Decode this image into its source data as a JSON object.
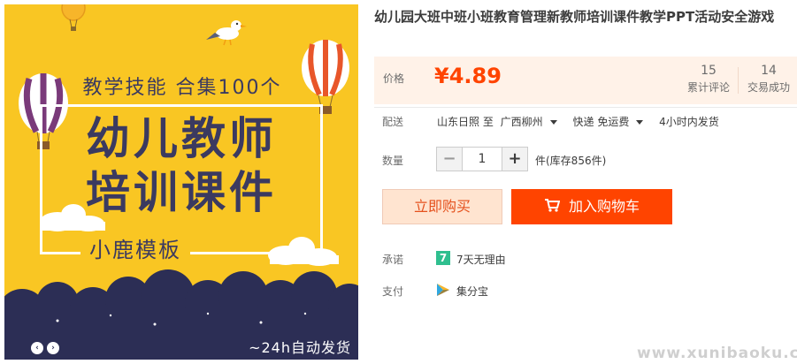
{
  "product": {
    "title": "幼儿园大班中班小班教育管理新教师培训课件教学PPT活动安全游戏"
  },
  "image": {
    "headline_small": "教学技能 合集100个",
    "headline_line1": "幼儿教师",
    "headline_line2": "培训课件",
    "brand": "小鹿模板",
    "shipping_badge": "~24h自动发货",
    "prev_arrow": "‹",
    "next_arrow": "›"
  },
  "price": {
    "label": "价格",
    "value": "¥4.89",
    "reviews_count": "15",
    "reviews_label": "累计评论",
    "sales_count": "14",
    "sales_label": "交易成功"
  },
  "delivery": {
    "label": "配送",
    "from": "山东日照 至",
    "to": "广西柳州",
    "method": "快递 免运费",
    "ship_time": "4小时内发货"
  },
  "quantity": {
    "label": "数量",
    "minus": "−",
    "value": "1",
    "plus": "+",
    "stock": "件(库存856件)"
  },
  "actions": {
    "buy_now": "立即购买",
    "add_to_cart": "加入购物车"
  },
  "services": {
    "promise_label": "承诺",
    "promise_badge": "7",
    "promise_text": "7天无理由",
    "pay_label": "支付",
    "pay_text": "集分宝"
  },
  "watermark": "www.xunibaoku.com",
  "colors": {
    "accent": "#ff4400",
    "price_panel_bg": "#fff2e8",
    "image_bg": "#f9c623",
    "navy": "#3b3a60",
    "promise_green": "#2fbf8f"
  },
  "icons": [
    "balloon-left-icon",
    "balloon-right-icon",
    "seagull-icon",
    "cart-icon",
    "seven-days-icon",
    "jifenbao-icon"
  ]
}
